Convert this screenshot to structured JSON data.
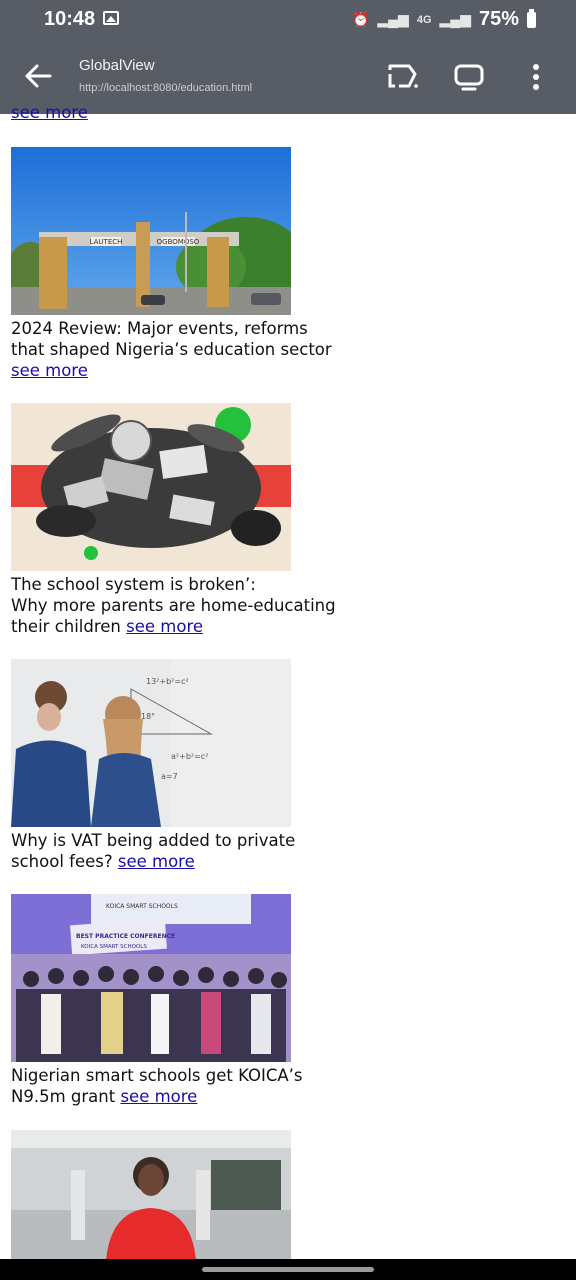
{
  "status_bar": {
    "time": "10:48",
    "network": "4G",
    "battery": "75%"
  },
  "app_bar": {
    "title": "GlobalView",
    "url": "http://localhost:8080/education.html"
  },
  "top_link": "see more",
  "articles": [
    {
      "headline": "2024 Review: Major events, reforms that shaped Nigeria’s education sector",
      "link": "see more",
      "image": "university-gate-photo"
    },
    {
      "headline_line1": "The school system is broken’:",
      "headline_line2": "Why more parents are home-educating their children",
      "link": "see more",
      "image": "home-education-collage"
    },
    {
      "headline": "Why is VAT being added to private school fees?",
      "link": "see more",
      "image": "students-at-whiteboard-photo"
    },
    {
      "headline": "Nigerian smart schools get KOICA’s N9.5m grant",
      "link": "see more",
      "image": "conference-group-photo",
      "banner_line1": "KOICA SMART SCHOOLS",
      "banner_line2": "BEST PRACTICE CONFERENCE",
      "banner_line3": "KOICA SMART SCHOOLS"
    },
    {
      "image": "woman-in-lab-photo"
    }
  ],
  "gate_signs": [
    "LAUTECH",
    "OGBOMOSO"
  ],
  "colors": {
    "bar": "#585c65",
    "link": "#1a0dab"
  }
}
